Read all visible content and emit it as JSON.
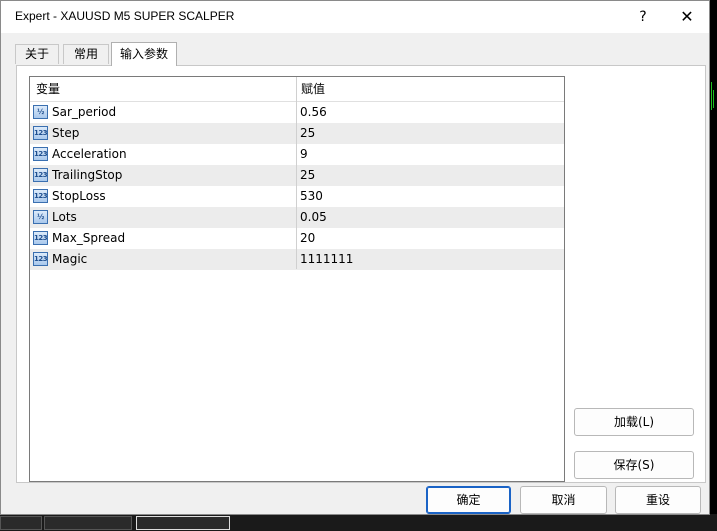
{
  "window": {
    "title": "Expert - XAUUSD M5 SUPER SCALPER",
    "help_glyph": "?",
    "close_glyph": "✕"
  },
  "tabs": [
    {
      "label": "关于",
      "active": false
    },
    {
      "label": "常用",
      "active": false
    },
    {
      "label": "输入参数",
      "active": true
    }
  ],
  "grid": {
    "columns": [
      "变量",
      "赋值"
    ],
    "rows": [
      {
        "icon": "fraction-icon",
        "icon_text": "½",
        "name": "Sar_period",
        "value": "0.56"
      },
      {
        "icon": "integer-icon",
        "icon_text": "123",
        "name": "Step",
        "value": "25"
      },
      {
        "icon": "integer-icon",
        "icon_text": "123",
        "name": "Acceleration",
        "value": "9"
      },
      {
        "icon": "integer-icon",
        "icon_text": "123",
        "name": "TrailingStop",
        "value": "25"
      },
      {
        "icon": "integer-icon",
        "icon_text": "123",
        "name": "StopLoss",
        "value": "530"
      },
      {
        "icon": "fraction-icon",
        "icon_text": "½",
        "name": "Lots",
        "value": "0.05"
      },
      {
        "icon": "integer-icon",
        "icon_text": "123",
        "name": "Max_Spread",
        "value": "20"
      },
      {
        "icon": "integer-icon",
        "icon_text": "123",
        "name": "Magic",
        "value": "1111111"
      }
    ]
  },
  "side_buttons": {
    "load": "加载(L)",
    "save": "保存(S)"
  },
  "footer_buttons": {
    "ok": "确定",
    "cancel": "取消",
    "reset": "重设"
  },
  "colors": {
    "accent": "#1a63c6",
    "row_alt": "#ececec",
    "chart_green": "#20c020"
  }
}
